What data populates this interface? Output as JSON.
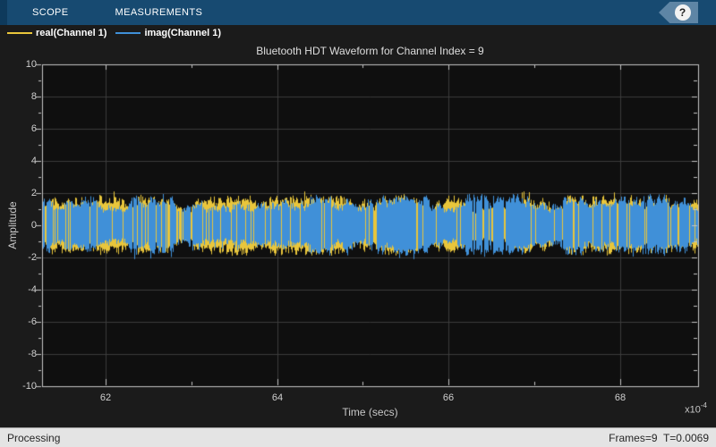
{
  "toolbar": {
    "tabs": [
      {
        "label": "SCOPE"
      },
      {
        "label": "MEASUREMENTS"
      }
    ],
    "help_label": "?"
  },
  "legend": {
    "items": [
      {
        "label": "real(Channel 1)"
      },
      {
        "label": "imag(Channel 1)"
      }
    ]
  },
  "status_bar": {
    "left": "Processing",
    "right": "Frames=9  T=0.0069"
  },
  "chart_data": {
    "type": "line",
    "title": "Bluetooth HDT Waveform for Channel Index = 9",
    "xlabel": "Time (secs)",
    "ylabel": "Amplitude",
    "x_multiplier_base": "x10",
    "x_multiplier_exp": "-4",
    "xlim": [
      61.26,
      68.91
    ],
    "ylim": [
      -10,
      10
    ],
    "xticks": [
      62,
      64,
      66,
      68
    ],
    "xminorticks": [
      63,
      65,
      67
    ],
    "yticks": [
      10,
      8,
      6,
      4,
      2,
      0,
      -2,
      -4,
      -6,
      -8,
      -10
    ],
    "yminorticks": [
      9,
      7,
      5,
      3,
      1,
      -1,
      -3,
      -5,
      -7,
      -9
    ],
    "grid": true,
    "legend_position": "top-left-bar",
    "series": [
      {
        "name": "real(Channel 1)",
        "color": "#E9C63B",
        "kind": "dense complex-baseband noise centered at 0",
        "approx_peak_amplitude": 0.9
      },
      {
        "name": "imag(Channel 1)",
        "color": "#4090D8",
        "kind": "dense complex-baseband noise centered at 0",
        "approx_peak_amplitude": 0.95
      }
    ],
    "noise_render": {
      "seed": 9
    },
    "colors": {
      "plot_background": "#0F0F0F",
      "outer_background": "#1B1B1B",
      "grid": "#3C3C3C",
      "axis": "#C4C4C4",
      "toolbar": "#174A71"
    }
  }
}
